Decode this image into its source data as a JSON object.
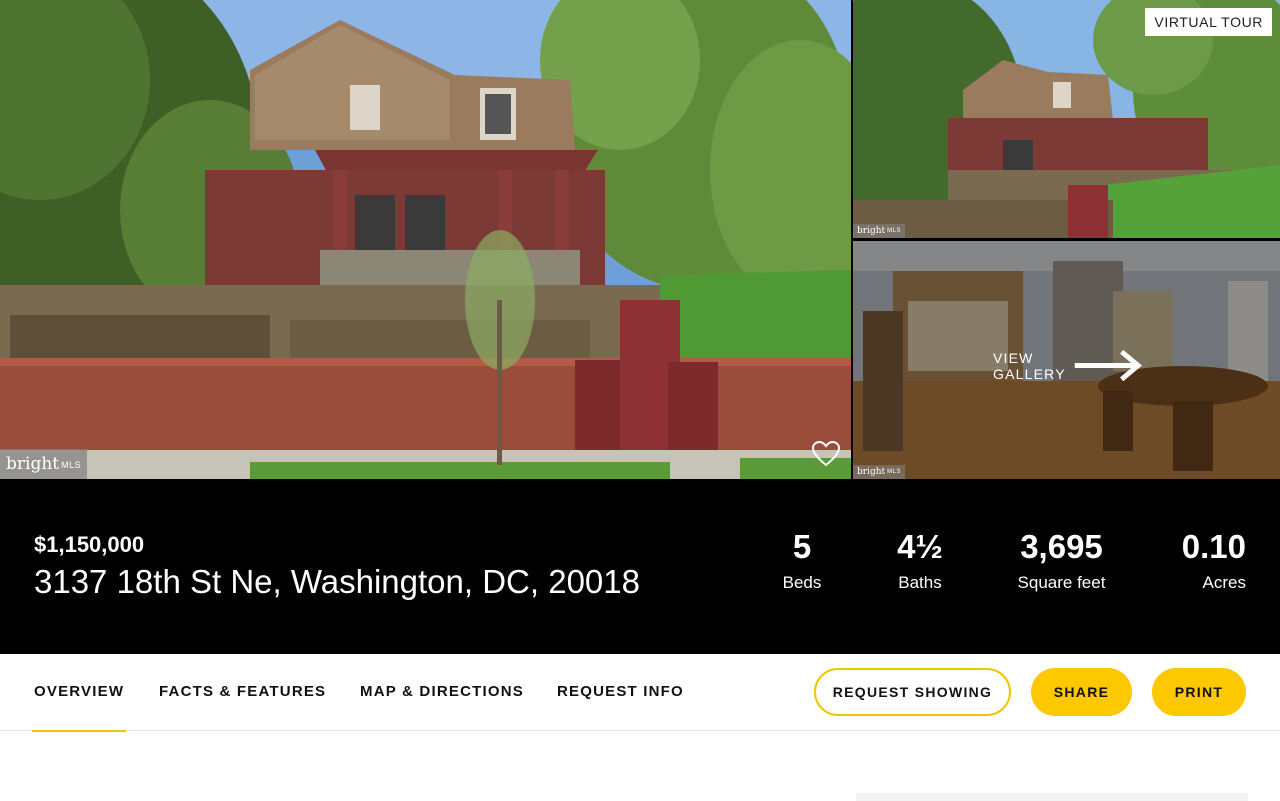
{
  "gallery": {
    "mls_brand": "bright",
    "mls_suffix": "MLS",
    "virtual_tour_label": "VIRTUAL TOUR",
    "view_gallery_label": "VIEW GALLERY",
    "favorite_icon": "heart-outline-icon"
  },
  "listing": {
    "price": "$1,150,000",
    "address": "3137 18th St Ne, Washington, DC, 20018",
    "stats": {
      "beds": {
        "value": "5",
        "label": "Beds"
      },
      "baths": {
        "value": "4½",
        "label": "Baths"
      },
      "sqft": {
        "value": "3,695",
        "label": "Square feet"
      },
      "acres": {
        "value": "0.10",
        "label": "Acres"
      }
    }
  },
  "nav": {
    "tabs": [
      {
        "label": "OVERVIEW",
        "active": true
      },
      {
        "label": "FACTS & FEATURES",
        "active": false
      },
      {
        "label": "MAP & DIRECTIONS",
        "active": false
      },
      {
        "label": "REQUEST INFO",
        "active": false
      }
    ],
    "request_showing_label": "REQUEST SHOWING",
    "share_label": "SHARE",
    "print_label": "PRINT"
  },
  "colors": {
    "accent": "#fcc900",
    "summary_bg": "#000000"
  }
}
